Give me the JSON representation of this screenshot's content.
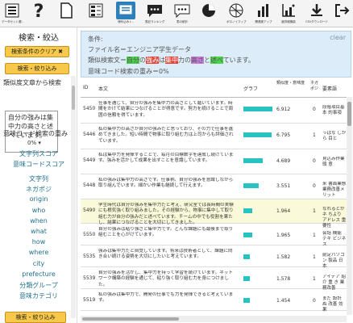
{
  "toolbar": [
    {
      "label": "データセット選..",
      "icon": "dataset-icon"
    },
    {
      "label": "",
      "icon": "help-icon"
    },
    {
      "label": "",
      "icon": "document-icon"
    },
    {
      "label": "",
      "icon": "table-list-icon"
    },
    {
      "label": "埋め込みト..",
      "icon": "embed-icon",
      "active": true
    },
    {
      "label": "表記ランキング",
      "icon": "chat-ranking-icon"
    },
    {
      "label": "表の統計",
      "icon": "chat-stats-icon"
    },
    {
      "label": "",
      "icon": "pie-chart-icon"
    },
    {
      "label": "ボロノイマップ",
      "icon": "voronoi-icon"
    },
    {
      "label": "関連度アップ",
      "icon": "bar-chart-icon"
    },
    {
      "label": "度詳細機能",
      "icon": "axis-chart-icon"
    },
    {
      "label": "CSVダウンロード",
      "icon": "download-icon"
    },
    {
      "label": "",
      "icon": "logout-icon"
    }
  ],
  "left": {
    "header": "検索・絞込",
    "clear_button": "検索条件のクリア ✖",
    "search_button": "検索・絞り込み",
    "similar_title": "類似度文章から検索",
    "similar_text": "自分の強みは集中力の高さと述べています。",
    "meaning_weight_title": "意味コード検索の重み",
    "meaning_weight_value": "0%",
    "links1": [
      "文字列スコア",
      "意味コードスコア"
    ],
    "links2": [
      "文字列",
      "ネガポジ",
      "origin",
      "who",
      "when",
      "what",
      "how",
      "where",
      "city",
      "prefecture",
      "分類グループ",
      "意味カテゴリ"
    ],
    "bottom_button": "検索・絞り込み"
  },
  "condition": {
    "title": "条件:",
    "filename": "ファイル名＝エンジニア学生データ",
    "similar_prefix": "類似検索文＝",
    "similar_parts": [
      "自分",
      "の",
      "強み",
      "は",
      "集中",
      "力の",
      "高さ",
      "と",
      "述べ",
      "ています。"
    ],
    "weight": "意味コード検索の重み＝0%",
    "clear": "clear"
  },
  "table": {
    "headers": {
      "id": "ID",
      "text": "本文",
      "graph": "グラフ",
      "score": "類似度・意味度",
      "neg": "ネガポジ",
      "tag": "要素語"
    },
    "rows": [
      {
        "id": "5450",
        "text": "仕事を通じて、自分の強みを集中力の高さとして磨いています。時間をかけて結果につなげることが得意です。努力を続けることで周囲の信頼を得ています。",
        "bar": 0.95,
        "score": "6.912",
        "neg": "0",
        "tag": "段階項目基本 的事項"
      },
      {
        "id": "5446",
        "text": "私の集中力の高さが自分の強みだと思っており、その力で仕事を進めてきました。短い時間で物事に取り組む力は上司からも評価されています。",
        "bar": 0.93,
        "score": "6.795",
        "neg": "1",
        "tag": "っぱな しから 目と"
      },
      {
        "id": "5449",
        "text": "私は集中力を発揮することで、毎月の目標数字を達成し続けています。強みを活かして成果を出すことを意識しています。",
        "bar": 0.64,
        "score": "4.689",
        "neg": "0",
        "tag": "見込み作業 頭 意"
      },
      {
        "id": "5448",
        "text": "私の強みは集中力の高さです。仕事柄、自分の強みを意識しながら取り組んでいます。細かい作業も継続して行えます。",
        "bar": 0.49,
        "score": "3.551",
        "neg": "0",
        "tag": "米 書面業態 業務改善メリット"
      },
      {
        "id": "5490",
        "text": "学生時代は自分の強みを集中力だと考え、研究室では長時間の実験にも根気強く取り組みました。その経験から、物事に集中して取り組む力が自分の強みだと述べています。チームの中でも役割を果たし、結果につなげることを大切にしてきました。",
        "bar": 0.28,
        "score": "1.964",
        "neg": "1",
        "tag": "なれるとか ネ ちより アドレス 重要性",
        "selected": true
      },
      {
        "id": "5550",
        "text": "自分の強みは粘り強さと集中力です。どんな課題にも最後まで取り組むことを心がけています。",
        "bar": 0.28,
        "score": "1.965",
        "neg": "1",
        "tag": "会話 機能 テキ ビジネス"
      },
      {
        "id": "5535",
        "text": "強みは集中力だと自覚しています。将来は技術者として、課題に向き合い続ける姿勢を大切にしたいと考えています。",
        "bar": 0.22,
        "score": "1.582",
        "neg": "1",
        "tag": "前定パソコン 製品 日 本"
      },
      {
        "id": "5539",
        "text": "自分の強みを活かし、集中力を持って学習を続けています。ネットワーク構築の経験を通じて、粘り強く取り組む力を身につけました。",
        "bar": 0.22,
        "score": "1.578",
        "neg": "1",
        "tag": "アイデア 紹介 重 き 業務改善"
      },
      {
        "id": "5519",
        "text": "私の強みは集中力で、開発の仕事でも力を発揮できると考えています。",
        "bar": 0.2,
        "score": "1.454",
        "neg": "0",
        "tag": "まだ 設計 ぬ 改善 効果"
      }
    ]
  }
}
